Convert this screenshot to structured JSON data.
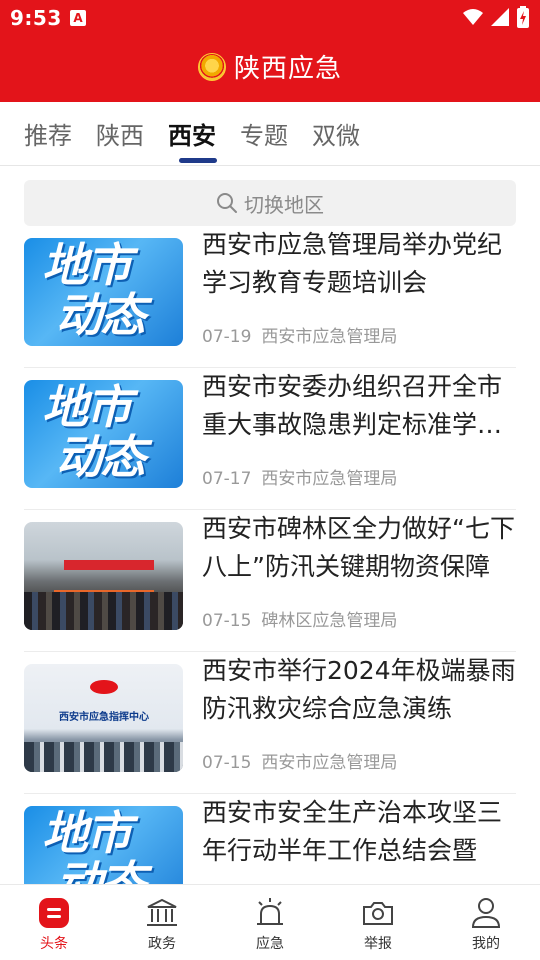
{
  "status_bar": {
    "time": "9:53",
    "app_icon_letter": "A",
    "icons": [
      "wifi-icon",
      "signal-icon",
      "battery-charging-icon"
    ]
  },
  "header": {
    "title": "陕西应急",
    "emblem_icon": "national-emblem-icon",
    "bg_color": "#e3141a"
  },
  "tabs": [
    {
      "label": "推荐",
      "active": false
    },
    {
      "label": "陕西",
      "active": false
    },
    {
      "label": "西安",
      "active": true
    },
    {
      "label": "专题",
      "active": false
    },
    {
      "label": "双微",
      "active": false
    }
  ],
  "search": {
    "placeholder": "切换地区",
    "icon": "search-icon"
  },
  "thumbnail_text": {
    "line1": "地市",
    "line2": "动态"
  },
  "photo_sign_text": "西安市应急指挥中心",
  "news": [
    {
      "title": "西安市应急管理局举办党纪学习教育专题培训会",
      "date": "07-19",
      "source": "西安市应急管理局",
      "thumb": "city-news"
    },
    {
      "title": "西安市安委办组织召开全市重大事故隐患判定标准学习宣贯会",
      "date": "07-17",
      "source": "西安市应急管理局",
      "thumb": "city-news"
    },
    {
      "title": "西安市碑林区全力做好“七下八上”防汛关键期物资保障",
      "date": "07-15",
      "source": "碑林区应急管理局",
      "thumb": "photo-crowd"
    },
    {
      "title": "西安市举行2024年极端暴雨防汛救灾综合应急演练",
      "date": "07-15",
      "source": "西安市应急管理局",
      "thumb": "photo-command-center"
    },
    {
      "title": "西安市安全生产治本攻坚三年行动半年工作总结会暨",
      "date": "",
      "source": "",
      "thumb": "city-news"
    }
  ],
  "bottom_nav": [
    {
      "label": "头条",
      "icon": "headline-icon",
      "active": true
    },
    {
      "label": "政务",
      "icon": "government-building-icon",
      "active": false
    },
    {
      "label": "应急",
      "icon": "alarm-light-icon",
      "active": false
    },
    {
      "label": "举报",
      "icon": "camera-icon",
      "active": false
    },
    {
      "label": "我的",
      "icon": "user-icon",
      "active": false
    }
  ],
  "colors": {
    "accent": "#e3141a",
    "tab_indicator": "#1f3a8a",
    "meta_text": "#999999"
  }
}
